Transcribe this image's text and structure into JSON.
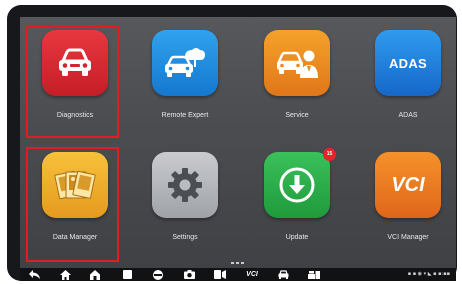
{
  "apps": [
    {
      "label": "Diagnostics",
      "icon": "car-icon",
      "color": "#d42a33"
    },
    {
      "label": "Remote Expert",
      "icon": "cloud-car-icon",
      "color": "#1f8ae0"
    },
    {
      "label": "Service",
      "icon": "service-car-icon",
      "color": "#ea8a22"
    },
    {
      "label": "ADAS",
      "icon_text": "ADAS",
      "color": "#2283dd"
    },
    {
      "label": "Data Manager",
      "icon": "photos-icon",
      "color": "#efae2c"
    },
    {
      "label": "Settings",
      "icon": "gear-icon",
      "color": "#b4b6ba"
    },
    {
      "label": "Update",
      "icon": "download-icon",
      "color": "#2cad4a",
      "badge": "15"
    },
    {
      "label": "VCI Manager",
      "icon_text": "VCI",
      "color": "#ea7a22"
    }
  ],
  "highlight_color": "#e01c25",
  "navbar": {
    "vci_label": "VCI",
    "icons": [
      "back-icon",
      "home-icon",
      "launcher-home-icon",
      "recent-apps-icon",
      "browser-icon",
      "camera-icon",
      "screen-record-icon",
      "vci-icon",
      "car-icon",
      "shop-icon"
    ]
  },
  "status_text": "▪ ▪ ◉ ▾ ◣ ▪ ▪:▪▪"
}
